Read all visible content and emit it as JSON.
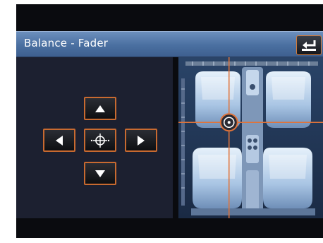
{
  "header": {
    "title": "Balance - Fader",
    "back_icon": "back-arrow-icon"
  },
  "controls": {
    "up_icon": "up-arrow-icon",
    "down_icon": "down-arrow-icon",
    "left_icon": "left-arrow-icon",
    "right_icon": "right-arrow-icon",
    "center_icon": "center-crosshair-icon"
  },
  "balance_fader": {
    "balance_fraction": 0.5,
    "fader_fraction": 0.33
  },
  "colors": {
    "accent": "#d8703a",
    "titlebar": "#4a6fa0",
    "background": "#0a0b0f"
  }
}
